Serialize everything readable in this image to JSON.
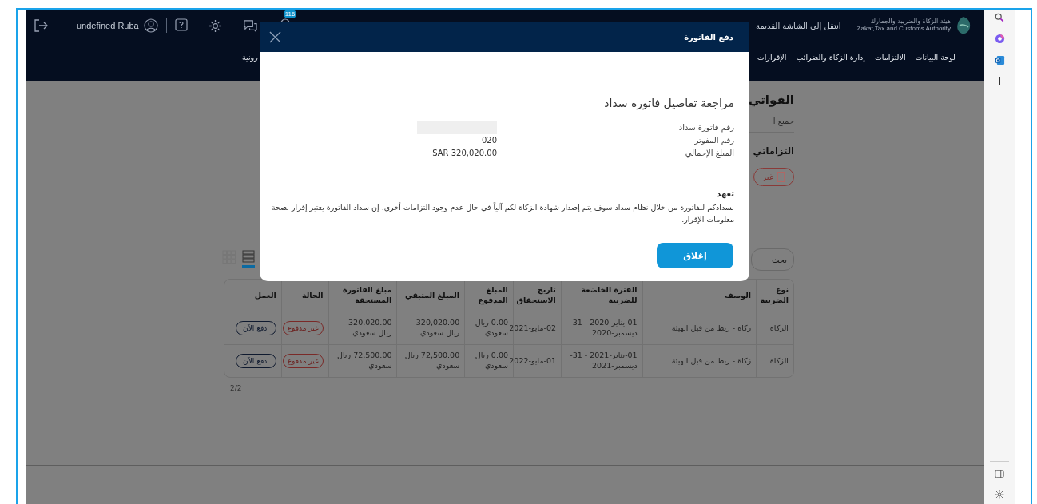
{
  "header": {
    "user": "undefined Ruba",
    "notification_count": "116",
    "authority_name_ar": "هيئة الزكاة والضريبة والجمارك",
    "authority_name_en": "Zakat,Tax and Customs Authority",
    "old_screen_link": "انتقل إلى الشاشة القديمة"
  },
  "nav": [
    {
      "label": "لوحة البيانات"
    },
    {
      "label": "الالتزامات"
    },
    {
      "label": "إدارة الزكاة والضرائب"
    },
    {
      "label": "الإقرارات"
    },
    {
      "label": "رونية"
    }
  ],
  "page": {
    "title": "الفواتي",
    "subtitle": "جميع ا",
    "section": "التزاماتي",
    "status_chip": "غير",
    "search": {
      "placeholder": "بحث"
    },
    "view_toggle": [
      {
        "kind": "grid",
        "selected": false
      },
      {
        "kind": "list",
        "selected": true
      }
    ],
    "table": {
      "columns": [
        "نوع الضريبة",
        "الوصف",
        "الفترة الخاضعة للضريبة",
        "تاريخ الاستحقاق",
        "المبلغ المدفوع",
        "المبلغ المتبقي",
        "مبلغ الفاتورة المستحقة",
        "الحالة",
        "العمل"
      ],
      "rows": [
        [
          "الزكاة",
          "زكاة - ربط من قبل الهيئة",
          "01-يناير-2020 - 31-ديسمبر-2020",
          "02-مايو-2021",
          "0.00 ريال سعودي",
          "320,020.00 ريال سعودي",
          "320,020.00 ريال سعودي",
          "غير مدفوع",
          "ادفع الآن"
        ],
        [
          "الزكاة",
          "زكاة - ربط من قبل الهيئة",
          "01-يناير-2021 - 31-ديسمبر-2021",
          "01-مايو-2022",
          "0.00 ريال سعودي",
          "72,500.00 ريال سعودي",
          "72,500.00 ريال سعودي",
          "غير مدفوع",
          "ادفع الآن"
        ]
      ]
    },
    "pagination": "2/2"
  },
  "modal": {
    "title": "دفع الفاتورة",
    "heading": "مراجعة تفاصيل فاتورة سداد",
    "details": [
      {
        "label": "رقم فاتورة سداد",
        "redacted": true
      },
      {
        "label": "رقم المفوتر",
        "value": "020",
        "redacted": false
      },
      {
        "label": "المبلغ الإجمالي",
        "value": "SAR 320,020.00",
        "redacted": false
      }
    ],
    "pledge_title": "تعهد",
    "pledge_text": "بسدادكم للفاتورة من خلال نظام سداد سوف يتم إصدار شهادة الزكاة لكم آلياً في حال عدم وجود التزامات أخرى. إن سداد الفاتورة يعتبر إقرار بصحة معلومات الإقرار.",
    "close_button": "إغلاق"
  }
}
